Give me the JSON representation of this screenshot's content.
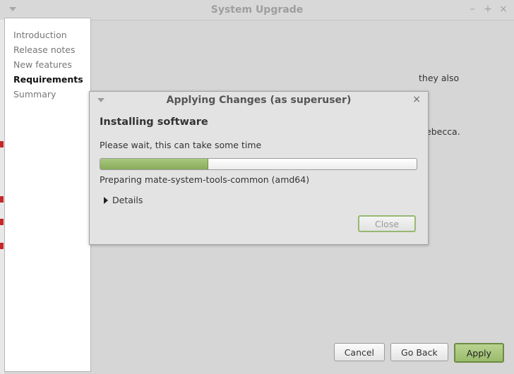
{
  "window": {
    "title": "System Upgrade",
    "controls": {
      "minimize": "–",
      "maximize": "+",
      "close": "×"
    }
  },
  "sidebar": {
    "items": [
      {
        "label": "Introduction"
      },
      {
        "label": "Release notes"
      },
      {
        "label": "New features"
      },
      {
        "label": "Requirements",
        "active": true
      },
      {
        "label": "Summary"
      }
    ]
  },
  "content": {
    "fragment_1": "they also",
    "fragment_2": "ebecca."
  },
  "footer": {
    "cancel_label": "Cancel",
    "go_back_label": "Go Back",
    "apply_label": "Apply"
  },
  "dialog": {
    "title": "Applying Changes (as superuser)",
    "close_icon": "×",
    "heading": "Installing software",
    "message": "Please wait, this can take some time",
    "progress": 0.34,
    "status": "Preparing mate-system-tools-common (amd64)",
    "details_label": "Details",
    "close_label": "Close"
  },
  "colors": {
    "accent_green": "#9abb6b",
    "progress_fill": "#89ac5a",
    "left_edge_marker": "#c62828"
  }
}
